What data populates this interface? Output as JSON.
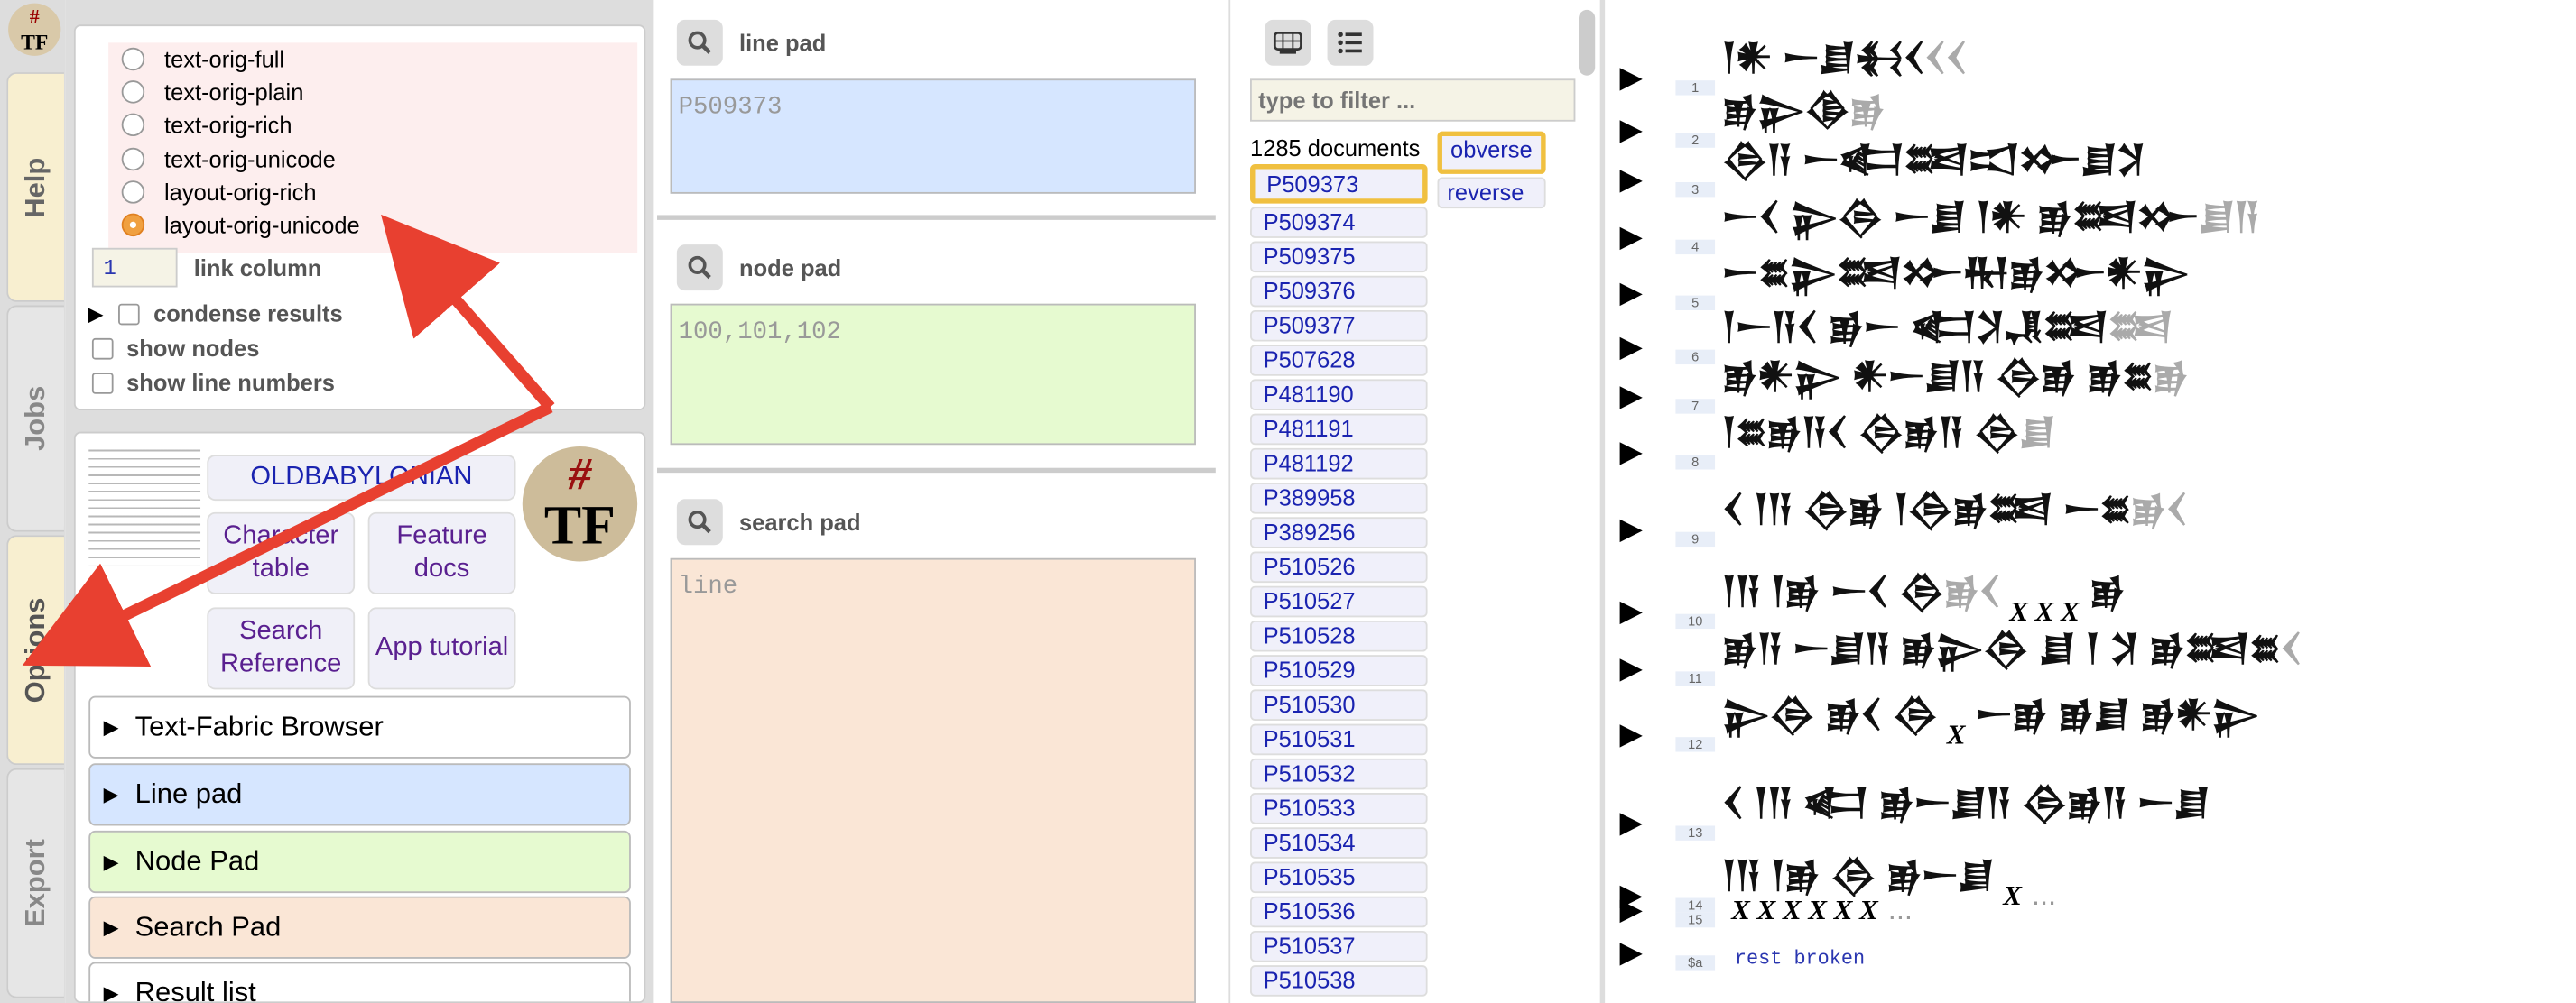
{
  "tabs": [
    "Help",
    "Jobs",
    "Options",
    "Export"
  ],
  "logo": {
    "hash": "#",
    "tf": "TF"
  },
  "options": {
    "formats": [
      "text-orig-full",
      "text-orig-plain",
      "text-orig-rich",
      "text-orig-unicode",
      "layout-orig-rich",
      "layout-orig-unicode"
    ],
    "selected_format": "layout-orig-unicode",
    "link_column_value": "1",
    "link_column_label": "link column",
    "condense_label": "condense results",
    "show_nodes_label": "show nodes",
    "show_line_numbers_label": "show line numbers"
  },
  "app": {
    "corpus": "OLDBABYLONIAN",
    "char_table": "Character table",
    "feature_docs": "Feature docs",
    "search_ref": "Search Reference",
    "app_tutorial": "App tutorial",
    "sections": [
      "Text-Fabric Browser",
      "Line pad",
      "Node Pad",
      "Search Pad",
      "Result list"
    ]
  },
  "pads": {
    "line_title": "line pad",
    "line_value": "P509373",
    "node_title": "node pad",
    "node_value": "100,101,102",
    "search_title": "search pad",
    "search_value": "line"
  },
  "docs": {
    "filter_placeholder": "type to filter ...",
    "count": "1285 documents",
    "items": [
      "P509373",
      "P509374",
      "P509375",
      "P509376",
      "P509377",
      "P507628",
      "P481190",
      "P481191",
      "P481192",
      "P389958",
      "P389256",
      "P510526",
      "P510527",
      "P510528",
      "P510529",
      "P510530",
      "P510531",
      "P510532",
      "P510533",
      "P510534",
      "P510535",
      "P510536",
      "P510537",
      "P510538"
    ],
    "selected": "P509373",
    "sides": [
      "obverse",
      "reverse"
    ],
    "selected_side": "obverse"
  },
  "text_lines": [
    {
      "n": "1",
      "signs": "𒁹𒀭 𒀸𒋗𒈬𒌋",
      "damaged": "𒌋𒌋"
    },
    {
      "n": "2",
      "signs": "𒂊𒉌𒆠",
      "damaged": "𒂊"
    },
    {
      "n": "3",
      "signs": "𒁲𒀀 𒀸𒅗𒌅𒀊𒁍𒋗𒋡",
      "damaged": ""
    },
    {
      "n": "4",
      "signs": "𒀸𒌋 𒉌𒁲 𒀸𒋗 𒁹𒀭 𒂊𒌅𒁍",
      "damaged": "𒋗𒀀"
    },
    {
      "n": "5",
      "signs": "𒀸𒊺𒉌𒌅𒁍𒊑𒂊𒁍𒀭𒉌",
      "damaged": ""
    },
    {
      "n": "6",
      "signs": "𒁹𒀸𒀀𒌋 𒂊𒀸 𒅗𒋡𒂗𒌅",
      "damaged": "𒌅"
    },
    {
      "n": "7",
      "signs": "𒂊𒀭𒉌 𒀭𒀸𒋗𒀀 𒁲𒂊 𒂊𒊺",
      "damaged": "𒂊"
    },
    {
      "n": "8",
      "signs": "𒁹𒊺𒂊𒀀𒌋 𒁲𒂊𒀀 𒁲",
      "damaged": "𒋗"
    },
    {
      "n": "9",
      "signs": "𒌋 𒁹𒀀 𒁲𒂊 𒁹𒁲𒂊𒌅 𒀸𒊺",
      "damaged": "𒂊𒌋"
    },
    {
      "n": "10",
      "signs": "𒁹𒀀 𒁹𒂊 𒀸𒌋 𒁲",
      "damaged": "𒂊𒌋",
      "x": "X X X",
      "tail": "𒂊"
    },
    {
      "n": "11",
      "signs": "𒂊𒀀 𒀸𒋗𒀀 𒂊𒉌𒁲 𒋗 𒁹 𒋡 𒂊𒌅𒊺",
      "damaged": "𒌋"
    },
    {
      "n": "12",
      "signs": "𒉌𒁲 𒂊𒌋 𒁲",
      "x": "X",
      "tail": "𒀸𒂊 𒂊𒋗 𒂊𒀭𒉌",
      "damaged": ""
    },
    {
      "n": "13",
      "signs": "𒌋 𒁹𒀀 𒅗 𒂊𒀸𒋗𒀀 𒁲𒂊𒀀 𒀸𒋗",
      "damaged": ""
    },
    {
      "n": "14",
      "signs": "𒁹𒀀 𒁹𒂊 𒁲 𒂊𒀸𒋗",
      "x": "X",
      "dots": "...",
      "damaged": ""
    },
    {
      "n": "15",
      "signs": "",
      "x": "X X X X X X",
      "dots": "...",
      "damaged": ""
    },
    {
      "n": "$a",
      "note": "rest broken",
      "signs": "",
      "damaged": ""
    }
  ],
  "colors": {
    "highlight": "#f0c040",
    "line_pad": "#d6e6ff",
    "node_pad": "#e6fad0",
    "search_pad": "#fae6d6",
    "arrow": "#e84030"
  }
}
